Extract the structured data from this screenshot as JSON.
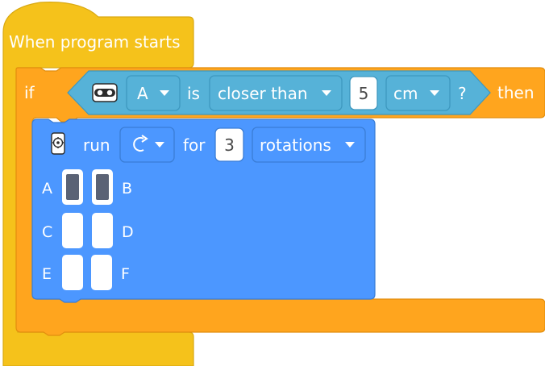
{
  "event": {
    "label": "When program starts"
  },
  "if_block": {
    "keyword_if": "if",
    "keyword_then": "then",
    "sensor_icon": "distance-sensor-icon",
    "port": "A",
    "is_label": "is",
    "comparison": "closer than",
    "distance_value": "5",
    "unit": "cm",
    "question_mark": "?"
  },
  "motor_block": {
    "icon": "motor-pair-icon",
    "run_label": "run",
    "direction_icon": "clockwise-icon",
    "for_label": "for",
    "amount": "3",
    "unit": "rotations",
    "port_grid": [
      {
        "left": "A",
        "right": "B",
        "selected": true
      },
      {
        "left": "C",
        "right": "D",
        "selected": false
      },
      {
        "left": "E",
        "right": "F",
        "selected": false
      }
    ]
  },
  "colors": {
    "event": "#F5C21B",
    "control": "#FFA51E",
    "sensor": "#56B2D8",
    "motor": "#4C97FF",
    "port_selected": "#5A6275"
  }
}
